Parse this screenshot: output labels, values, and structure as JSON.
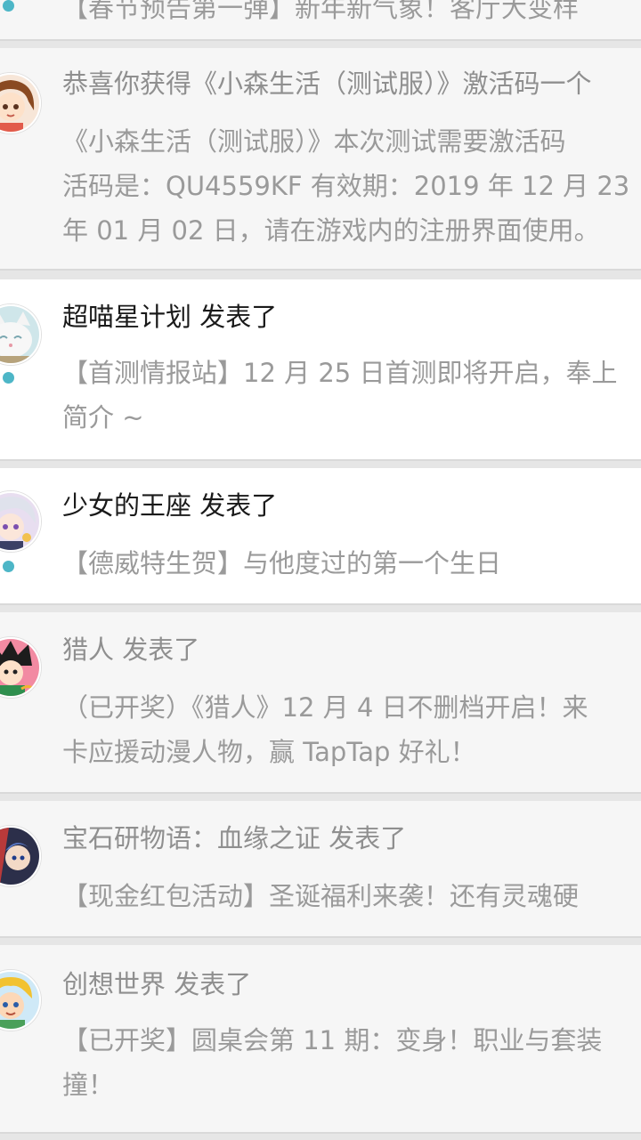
{
  "notifications": [
    {
      "state": "read",
      "title": "",
      "lines": [
        "【春节预告第一弹】新年新气象！客厅大变样"
      ]
    },
    {
      "state": "read",
      "title": "恭喜你获得《小森生活（测试服）》激活码一个",
      "lines": [
        "《小森生活（测试服）》本次测试需要激活码",
        "活码是：QU4559KF 有效期：2019 年 12 月 23",
        "年 01 月 02 日，请在游戏内的注册界面使用。"
      ],
      "avatar_icon": "girl-avatar-icon"
    },
    {
      "state": "unread",
      "title": "超喵星计划 发表了",
      "lines": [
        "【首测情报站】12 月 25 日首测即将开启，奉上",
        "简介 ~"
      ],
      "avatar_icon": "cat-avatar-icon"
    },
    {
      "state": "unread",
      "title": "少女的王座 发表了",
      "lines": [
        "【德威特生贺】与他度过的第一个生日"
      ],
      "avatar_icon": "anime-boy-avatar-icon"
    },
    {
      "state": "read",
      "title": "猎人 发表了",
      "lines": [
        "（已开奖）《猎人》12 月 4 日不删档开启！来",
        "卡应援动漫人物，赢 TapTap 好礼！"
      ],
      "avatar_icon": "hunter-avatar-icon"
    },
    {
      "state": "read",
      "title": "宝石研物语：血缘之证 发表了",
      "lines": [
        "【现金红包活动】圣诞福利来袭！还有灵魂硬"
      ],
      "avatar_icon": "gem-game-avatar-icon"
    },
    {
      "state": "read",
      "title": "创想世界 发表了",
      "lines": [
        "【已开奖】圆桌会第 11 期：变身！职业与套装",
        "撞！"
      ],
      "avatar_icon": "cartoon-boy-avatar-icon"
    }
  ],
  "colors": {
    "unread_dot": "#4db6c7",
    "card_read_bg": "#f6f6f6",
    "card_unread_bg": "#ffffff"
  }
}
